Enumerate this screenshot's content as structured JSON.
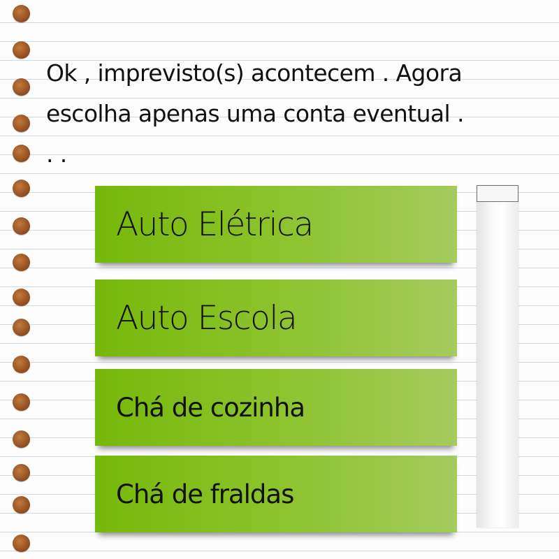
{
  "prompt": {
    "line1": "Ok , imprevisto(s) acontecem . Agora",
    "line2": "escolha apenas uma conta eventual .",
    "line3": ". ."
  },
  "options": [
    {
      "label": "Auto Elétrica"
    },
    {
      "label": "Auto Escola"
    },
    {
      "label": "Chá de cozinha"
    },
    {
      "label": "Chá de fraldas"
    }
  ],
  "colors": {
    "option_green_start": "#76b80a",
    "option_green_end": "#a3cb5e",
    "binder_hole": "#9a5524"
  }
}
